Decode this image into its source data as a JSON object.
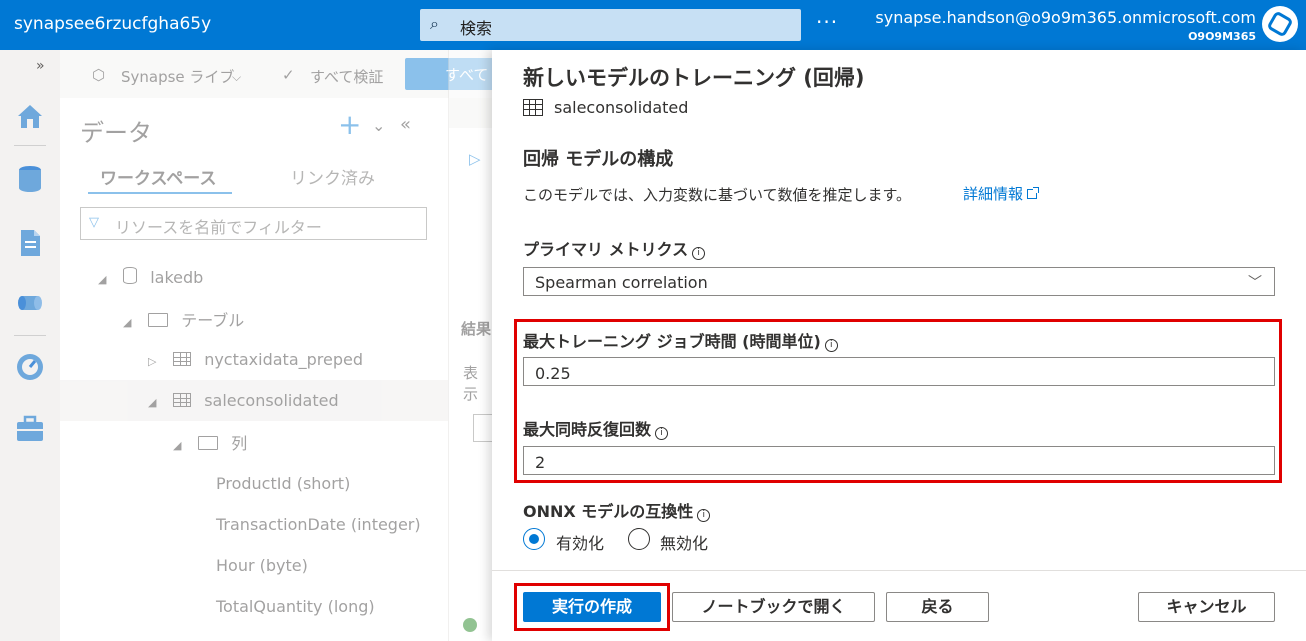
{
  "topbar": {
    "workspace_name": "synapsee6rzucfgha65y",
    "search_placeholder": "検索",
    "more": "···",
    "user_email": "synapse.handson@o9o9m365.onmicrosoft.com",
    "user_tenant": "O9O9M365"
  },
  "toolbar": {
    "synapse_live": "Synapse ライブ",
    "validate_all": "すべて検証",
    "publish_all": "すべて"
  },
  "data_pane": {
    "title": "データ",
    "tabs": {
      "workspace": "ワークスペース",
      "linked": "リンク済み"
    },
    "filter_placeholder": "リソースを名前でフィルター",
    "tree": {
      "lakedb": "lakedb",
      "tables": "テーブル",
      "table1": "nyctaxidata_preped",
      "table2": "saleconsolidated",
      "columns": "列",
      "col1": "ProductId (short)",
      "col2": "TransactionDate (integer)",
      "col3": "Hour (byte)",
      "col4": "TotalQuantity (long)"
    }
  },
  "middle": {
    "results": "結果",
    "view": "表示"
  },
  "dialog": {
    "title": "新しいモデルのトレーニング (回帰)",
    "table_name": "saleconsolidated",
    "section_title": "回帰 モデルの構成",
    "description": "このモデルでは、入力変数に基づいて数値を推定します。",
    "details_link": "詳細情報",
    "primary_metric_label": "プライマリ メトリクス",
    "primary_metric_value": "Spearman correlation",
    "max_training_label": "最大トレーニング ジョブ時間 (時間単位)",
    "max_training_value": "0.25",
    "max_concurrent_label": "最大同時反復回数",
    "max_concurrent_value": "2",
    "onnx_label": "ONNX モデルの互換性",
    "onnx_enable": "有効化",
    "onnx_disable": "無効化",
    "buttons": {
      "create_run": "実行の作成",
      "open_notebook": "ノートブックで開く",
      "back": "戻る",
      "cancel": "キャンセル"
    }
  },
  "colors": {
    "accent": "#0078d4",
    "highlight": "#e00000"
  }
}
